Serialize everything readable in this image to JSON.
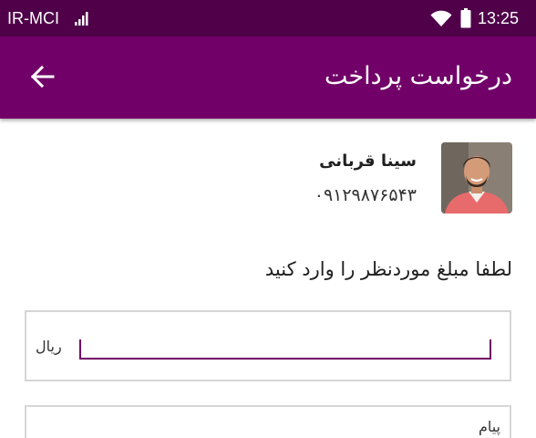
{
  "status_bar": {
    "carrier": "IR-MCI",
    "time": "13:25",
    "icons": [
      "signal-icon",
      "wifi-icon",
      "battery-icon"
    ]
  },
  "app_bar": {
    "title": "درخواست پرداخت",
    "back_icon": "arrow-back-icon",
    "color": "#710068",
    "status_color": "#4f0049"
  },
  "user": {
    "name": "سینا قربانی",
    "phone": "۰۹۱۲۹۸۷۶۵۴۳"
  },
  "form": {
    "prompt": "لطفا مبلغ موردنظر را وارد کنید",
    "amount_value": "",
    "currency": "ریال",
    "message_label": "پیام"
  }
}
